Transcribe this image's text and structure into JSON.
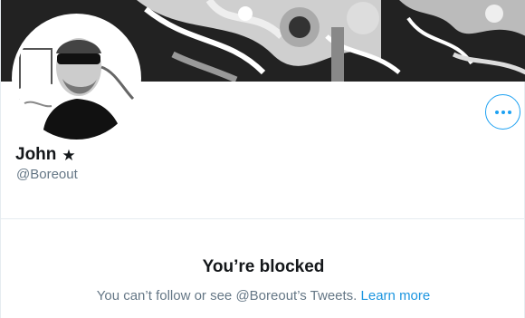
{
  "profile": {
    "display_name": "John",
    "badge_icon": "star-icon",
    "badge_glyph": "★",
    "handle": "@Boreout"
  },
  "actions": {
    "more_icon": "more-horizontal-icon"
  },
  "blocked": {
    "title": "You’re blocked",
    "message": "You can’t follow or see @Boreout’s Tweets.",
    "link_label": "Learn more"
  },
  "colors": {
    "accent": "#1da1f2",
    "link": "#1b95e0",
    "text_primary": "#14171a",
    "text_secondary": "#657786",
    "border": "#e6ecf0"
  }
}
